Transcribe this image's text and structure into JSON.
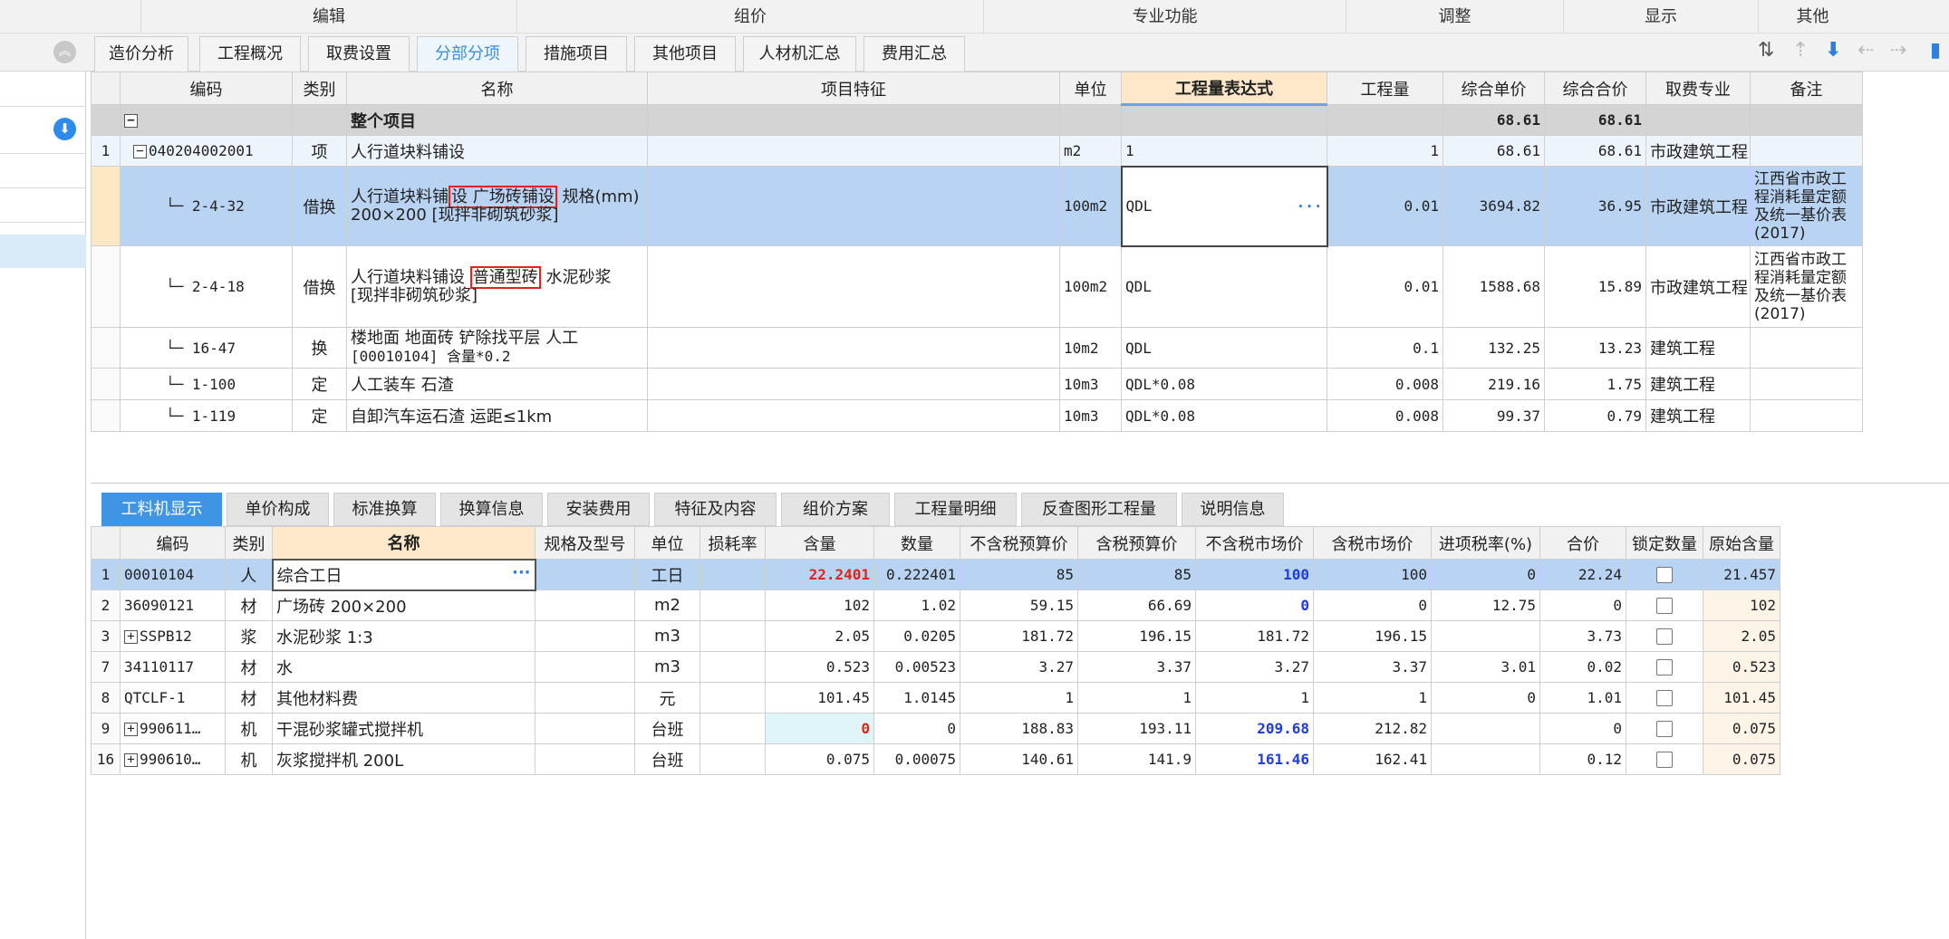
{
  "ribbon": {
    "groups": [
      "编辑",
      "组价",
      "专业功能",
      "调整",
      "显示",
      "其他"
    ]
  },
  "top_tabs": [
    "造价分析",
    "工程概况",
    "取费设置",
    "分部分项",
    "措施项目",
    "其他项目",
    "人材机汇总",
    "费用汇总"
  ],
  "active_top_tab": "分部分项",
  "upper_grid": {
    "headers": [
      "编码",
      "类别",
      "名称",
      "项目特征",
      "单位",
      "工程量表达式",
      "工程量",
      "综合单价",
      "综合合价",
      "取费专业",
      "备注"
    ],
    "total_row": {
      "name": "整个项目",
      "unit_price": "68.61",
      "total_price": "68.61"
    },
    "item_row": {
      "row_no": "1",
      "code": "040204002001",
      "type": "项",
      "name": "人行道块料铺设",
      "unit": "m2",
      "expr": "1",
      "qty": "1",
      "unit_price": "68.61",
      "total_price": "68.61",
      "specialty": "市政建筑工程"
    },
    "rows": [
      {
        "code": "2-4-32",
        "type": "借换",
        "name_a": "人行道块料铺",
        "name_box": "设 广场砖铺设",
        "name_b": " 规格(mm)",
        "name_line2": "200×200  [现拌非砌筑砂浆]",
        "unit": "100m2",
        "expr": "QDL",
        "qty": "0.01",
        "unit_price": "3694.82",
        "total_price": "36.95",
        "specialty": "市政建筑工程",
        "note": "江西省市政工程消耗量定额及统一基价表(2017)"
      },
      {
        "code": "2-4-18",
        "type": "借换",
        "name_a": "人行道块料铺设 ",
        "name_box": "普通型砖",
        "name_b": " 水泥砂浆",
        "name_line2": " [现拌非砌筑砂浆]",
        "unit": "100m2",
        "expr": "QDL",
        "qty": "0.01",
        "unit_price": "1588.68",
        "total_price": "15.89",
        "specialty": "市政建筑工程",
        "note": "江西省市政工程消耗量定额及统一基价表(2017)"
      },
      {
        "code": "16-47",
        "type": "换",
        "name_a": "楼地面 地面砖  铲除找平层 人工",
        "name_line2": "[00010104] 含量*0.2",
        "unit": "10m2",
        "expr": "QDL",
        "qty": "0.1",
        "unit_price": "132.25",
        "total_price": "13.23",
        "specialty": "建筑工程",
        "note": ""
      },
      {
        "code": "1-100",
        "type": "定",
        "name_a": "人工装车 石渣",
        "unit": "10m3",
        "expr": "QDL*0.08",
        "qty": "0.008",
        "unit_price": "219.16",
        "total_price": "1.75",
        "specialty": "建筑工程",
        "note": ""
      },
      {
        "code": "1-119",
        "type": "定",
        "name_a": "自卸汽车运石渣 运距≤1km",
        "unit": "10m3",
        "expr": "QDL*0.08",
        "qty": "0.008",
        "unit_price": "99.37",
        "total_price": "0.79",
        "specialty": "建筑工程",
        "note": ""
      }
    ],
    "tree_collapse": "−",
    "dots": "···"
  },
  "lower_tabs": [
    "工料机显示",
    "单价构成",
    "标准换算",
    "换算信息",
    "安装费用",
    "特征及内容",
    "组价方案",
    "工程量明细",
    "反查图形工程量",
    "说明信息"
  ],
  "active_lower_tab": "工料机显示",
  "lower_grid": {
    "headers": [
      "编码",
      "类别",
      "名称",
      "规格及型号",
      "单位",
      "损耗率",
      "含量",
      "数量",
      "不含税预算价",
      "含税预算价",
      "不含税市场价",
      "含税市场价",
      "进项税率(%)",
      "合价",
      "锁定数量",
      "原始含量"
    ],
    "rows": [
      {
        "no": "1",
        "code": "00010104",
        "type": "人",
        "name": "综合工日",
        "spec": "",
        "unit": "工日",
        "loss": "",
        "content": "22.2401",
        "qty": "0.222401",
        "budget_ex": "85",
        "budget_in": "85",
        "market_ex": "100",
        "market_in": "100",
        "tax": "0",
        "total": "22.24",
        "orig": "21.457"
      },
      {
        "no": "2",
        "code": "36090121",
        "type": "材",
        "name": "广场砖 200×200",
        "spec": "",
        "unit": "m2",
        "loss": "",
        "content": "102",
        "qty": "1.02",
        "budget_ex": "59.15",
        "budget_in": "66.69",
        "market_ex": "0",
        "market_in": "0",
        "tax": "12.75",
        "total": "0",
        "orig": "102"
      },
      {
        "no": "3",
        "code": "SSPB12",
        "type": "浆",
        "name": "水泥砂浆 1:3",
        "spec": "",
        "unit": "m3",
        "loss": "",
        "content": "2.05",
        "qty": "0.0205",
        "budget_ex": "181.72",
        "budget_in": "196.15",
        "market_ex": "181.72",
        "market_in": "196.15",
        "tax": "",
        "total": "3.73",
        "orig": "2.05"
      },
      {
        "no": "7",
        "code": "34110117",
        "type": "材",
        "name": "水",
        "spec": "",
        "unit": "m3",
        "loss": "",
        "content": "0.523",
        "qty": "0.00523",
        "budget_ex": "3.27",
        "budget_in": "3.37",
        "market_ex": "3.27",
        "market_in": "3.37",
        "tax": "3.01",
        "total": "0.02",
        "orig": "0.523"
      },
      {
        "no": "8",
        "code": "QTCLF-1",
        "type": "材",
        "name": "其他材料费",
        "spec": "",
        "unit": "元",
        "loss": "",
        "content": "101.45",
        "qty": "1.0145",
        "budget_ex": "1",
        "budget_in": "1",
        "market_ex": "1",
        "market_in": "1",
        "tax": "0",
        "total": "1.01",
        "orig": "101.45"
      },
      {
        "no": "9",
        "code": "990611…",
        "type": "机",
        "name": "干混砂浆罐式搅拌机",
        "spec": "",
        "unit": "台班",
        "loss": "",
        "content": "0",
        "qty": "0",
        "budget_ex": "188.83",
        "budget_in": "193.11",
        "market_ex": "209.68",
        "market_in": "212.82",
        "tax": "",
        "total": "0",
        "orig": "0.075"
      },
      {
        "no": "16",
        "code": "990610…",
        "type": "机",
        "name": "灰浆搅拌机 200L",
        "spec": "",
        "unit": "台班",
        "loss": "",
        "content": "0.075",
        "qty": "0.00075",
        "budget_ex": "140.61",
        "budget_in": "141.9",
        "market_ex": "161.46",
        "market_in": "162.41",
        "tax": "",
        "total": "0.12",
        "orig": "0.075"
      }
    ],
    "plus": "+"
  },
  "icons": {
    "collapse": "collapse-up-icon",
    "download": "download-circle-icon"
  },
  "colors": {
    "accent": "#3f94e4",
    "highlight_header": "#fde9c9",
    "selected_row": "#b9d4f3",
    "red_text": "#e2231a",
    "blue_text": "#1f3ed8"
  }
}
